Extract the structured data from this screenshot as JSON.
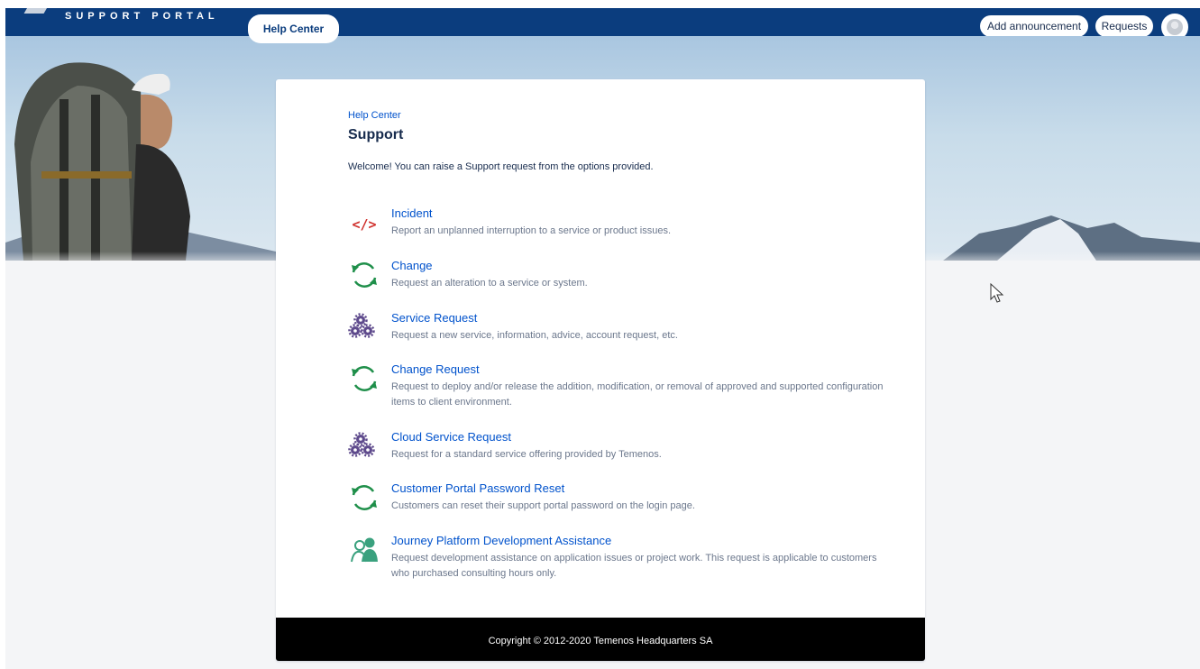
{
  "header": {
    "logo_text": "SUPPORT PORTAL",
    "help_center_tab": "Help Center",
    "add_announcement_label": "Add announcement",
    "requests_label": "Requests",
    "brand_color": "#0b3d7e"
  },
  "card": {
    "breadcrumb": "Help Center",
    "title": "Support",
    "welcome": "Welcome! You can raise a Support request from the options provided."
  },
  "request_types": [
    {
      "icon": "code-icon",
      "name": "Incident",
      "description": "Report an unplanned interruption to a service or product issues."
    },
    {
      "icon": "refresh-cycle-icon",
      "name": "Change",
      "description": "Request an alteration to a service or system."
    },
    {
      "icon": "gears-icon",
      "name": "Service Request",
      "description": "Request a new service, information, advice, account request, etc."
    },
    {
      "icon": "refresh-cycle-icon",
      "name": "Change Request",
      "description": "Request to deploy and/or release the addition, modification, or removal of approved and supported configuration items to client environment."
    },
    {
      "icon": "gears-icon",
      "name": "Cloud Service Request",
      "description": "Request for a standard service offering provided by Temenos."
    },
    {
      "icon": "refresh-cycle-icon",
      "name": "Customer Portal Password Reset",
      "description": "Customers can reset their support portal password on the login page."
    },
    {
      "icon": "users-icon",
      "name": "Journey Platform Development Assistance",
      "description": "Request development assistance on application issues or project work. This request is applicable to customers who purchased consulting hours only."
    }
  ],
  "footer": {
    "copyright": "Copyright © 2012-2020 Temenos Headquarters SA"
  }
}
